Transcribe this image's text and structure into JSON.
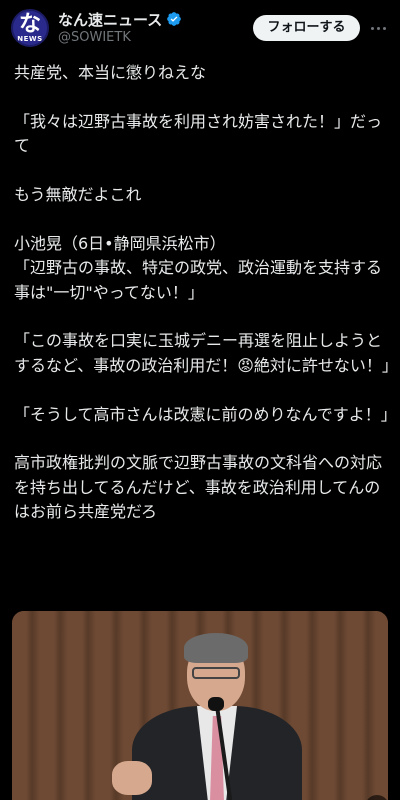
{
  "account": {
    "avatar_glyph": "な",
    "avatar_sub": "NEWS",
    "display_name": "なん速ニュース",
    "handle": "@SOWIETK",
    "follow_label": "フォローする"
  },
  "post": {
    "lines": [
      "共産党、本当に懲りねえな",
      "",
      "「我々は辺野古事故を利用され妨害された！」だって",
      "",
      "もう無敵だよこれ",
      "",
      "小池晃（6日•静岡県浜松市）",
      "「辺野古の事故、特定の政党、政治運動を支持する事は\"一切\"やってない！」",
      "",
      "「この事故を口実に玉城デニー再選を阻止しようとするなど、事故の政治利用だ！😡絶対に許せない！」",
      "",
      "「そうして高市さんは改憲に前のめりなんですよ！」",
      "",
      "高市政権批判の文脈で辺野古事故の文科省への対応を持ち出してるんだけど、事故を政治利用してんのはお前ら共産党だろ"
    ]
  },
  "colors": {
    "background": "#000000",
    "text": "#e7e9ea",
    "secondary": "#71767b",
    "verified": "#1d9bf0",
    "follow_bg": "#eff3f4"
  }
}
